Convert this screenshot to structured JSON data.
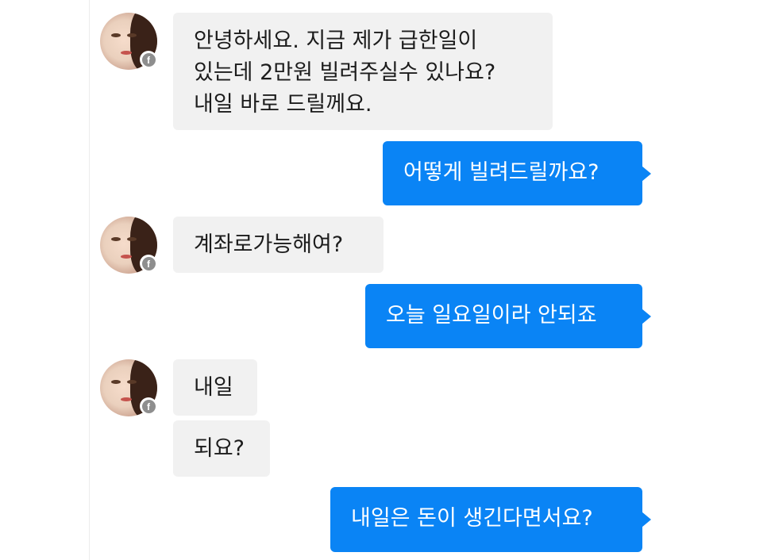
{
  "messages": [
    {
      "direction": "incoming",
      "lines": [
        "안녕하세요. 지금 제가 급한일이",
        "있는데 2만원 빌려주실수 있나요?",
        "내일 바로 드릴께요."
      ]
    },
    {
      "direction": "outgoing",
      "text": "어떻게 빌려드릴까요?"
    },
    {
      "direction": "incoming",
      "text": "계좌로가능해여?"
    },
    {
      "direction": "outgoing",
      "text": "오늘 일요일이라 안되죠"
    },
    {
      "direction": "incoming",
      "text": "내일"
    },
    {
      "direction": "incoming",
      "text": "되요?"
    },
    {
      "direction": "outgoing",
      "text": "내일은 돈이 생긴다면서요?"
    }
  ],
  "avatar_badge": "f",
  "icons": {
    "avatar": "profile-avatar-icon",
    "badge": "facebook-badge-icon"
  },
  "colors": {
    "outgoing_bubble": "#0a84f5",
    "incoming_bubble": "#f1f1f1",
    "incoming_text": "#1c1c1c",
    "outgoing_text": "#ffffff",
    "badge": "#8e8e8e"
  }
}
